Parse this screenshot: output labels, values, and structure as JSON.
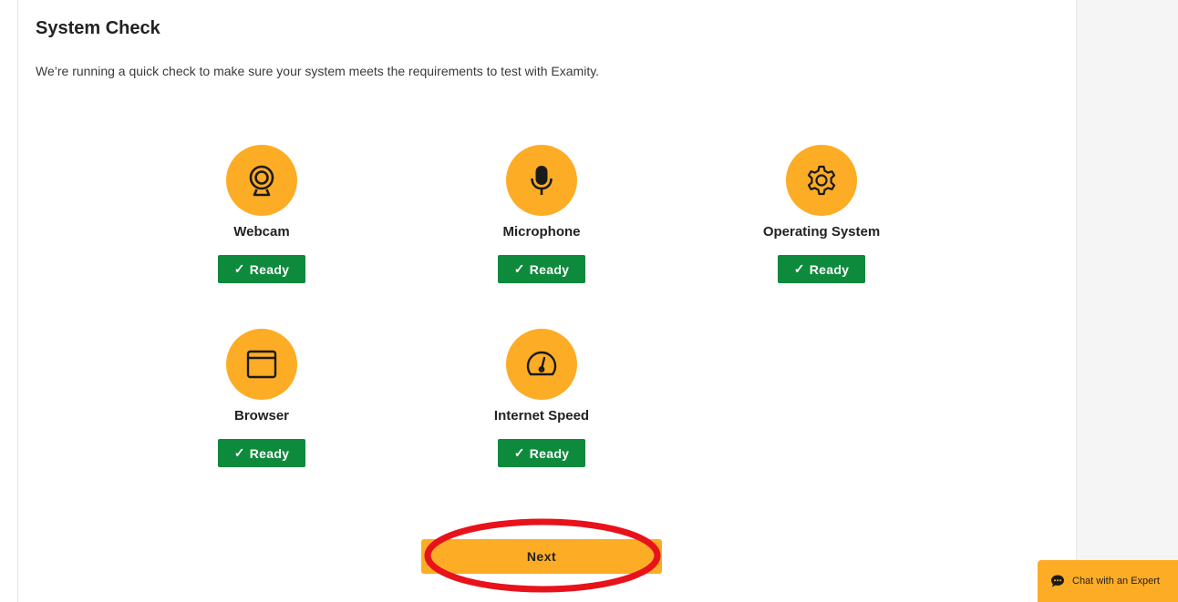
{
  "header": {
    "title": "System Check",
    "intro": "We’re running a quick check to make sure your system meets the requirements to test with Examity."
  },
  "checks": [
    {
      "label": "Webcam",
      "status": "Ready",
      "icon": "webcam-icon"
    },
    {
      "label": "Microphone",
      "status": "Ready",
      "icon": "microphone-icon"
    },
    {
      "label": "Operating System",
      "status": "Ready",
      "icon": "gear-icon"
    },
    {
      "label": "Browser",
      "status": "Ready",
      "icon": "browser-window-icon"
    },
    {
      "label": "Internet Speed",
      "status": "Ready",
      "icon": "speedometer-icon"
    }
  ],
  "actions": {
    "next_label": "Next"
  },
  "chat": {
    "label": "Chat with an Expert",
    "icon": "chat-bubble-icon"
  },
  "colors": {
    "accent": "#fdac26",
    "ready": "#0e8a3c",
    "highlight": "#e8121b"
  }
}
